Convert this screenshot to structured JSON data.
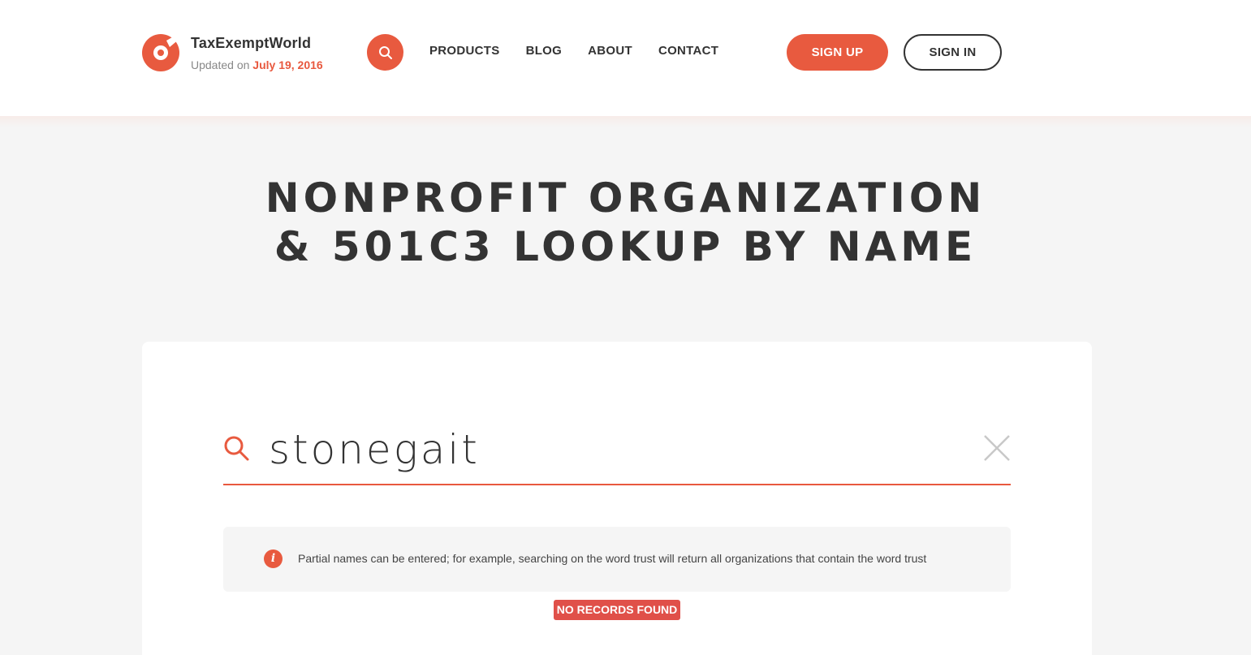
{
  "header": {
    "brand_name": "TaxExemptWorld",
    "updated_prefix": "Updated on ",
    "updated_date": "July 19, 2016",
    "nav": [
      "PRODUCTS",
      "BLOG",
      "ABOUT",
      "CONTACT"
    ],
    "signup_label": "SIGN UP",
    "signin_label": "SIGN IN"
  },
  "title": {
    "line1": "NONPROFIT ORGANIZATION",
    "line2": "& 501C3 LOOKUP BY NAME"
  },
  "search": {
    "value": "stonegait"
  },
  "info": {
    "icon": "i",
    "text": "Partial names can be entered; for example, searching on the word trust will return all organizations that contain the word trust"
  },
  "status": {
    "label": "NO RECORDS FOUND"
  },
  "colors": {
    "accent": "#e85a3f",
    "text": "#333333",
    "background": "#f5f5f5",
    "error_badge": "#e05049"
  }
}
